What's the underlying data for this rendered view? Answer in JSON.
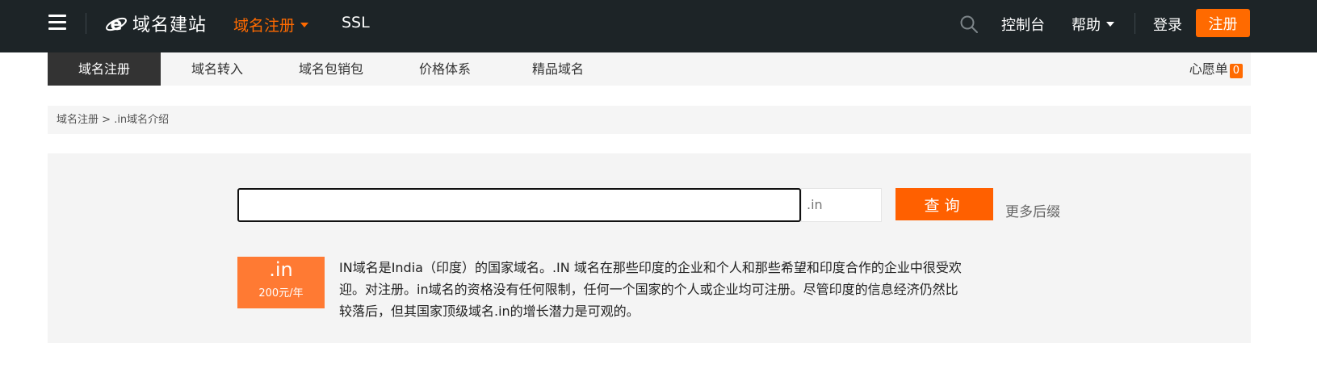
{
  "topbar": {
    "logo_text": "域名建站",
    "nav": [
      {
        "label": "域名注册",
        "active": true
      },
      {
        "label": "SSL",
        "active": false
      }
    ],
    "console": "控制台",
    "help": "帮助",
    "login": "登录",
    "register": "注册"
  },
  "subnav": {
    "items": [
      "域名注册",
      "域名转入",
      "域名包销包",
      "价格体系",
      "精品域名"
    ],
    "wishlist_label": "心愿单",
    "wishlist_count": "0"
  },
  "breadcrumb": {
    "home": "域名注册",
    "separator": " > ",
    "current": ".in域名介绍"
  },
  "search": {
    "value": "",
    "suffix": ".in",
    "query_button": "查询",
    "more_suffix": "更多后缀"
  },
  "tld_info": {
    "tld": ".in",
    "price": "200元/年",
    "description": "IN域名是India（印度）的国家域名。.IN 域名在那些印度的企业和个人和那些希望和印度合作的企业中很受欢迎。对注册。in域名的资格没有任何限制，任何一个国家的个人或企业均可注册。尽管印度的信息经济仍然比较落后，但其国家顶级域名.in的增长潜力是可观的。"
  },
  "colors": {
    "topbar_bg": "#1d2427",
    "accent": "#ff6a00",
    "price_tag": "#ff7a33"
  }
}
